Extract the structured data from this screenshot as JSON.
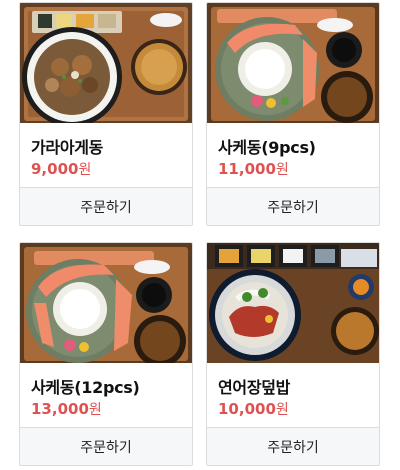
{
  "menu": {
    "items": [
      {
        "name": "가라아게동",
        "price": "9,000",
        "currency": "원",
        "order_label": "주문하기",
        "photo": "karaage-don-photo"
      },
      {
        "name": "사케동(9pcs)",
        "price": "11,000",
        "currency": "원",
        "order_label": "주문하기",
        "photo": "sake-don-photo"
      },
      {
        "name": "사케동(12pcs)",
        "price": "13,000",
        "currency": "원",
        "order_label": "주문하기",
        "photo": "sake-don-photo"
      },
      {
        "name": "연어장덮밥",
        "price": "10,000",
        "currency": "원",
        "order_label": "주문하기",
        "photo": "salmon-jang-bowl-photo"
      }
    ]
  },
  "colors": {
    "price": "#e05252",
    "order_bg": "#f6f7f9",
    "border": "#dcdcdc"
  }
}
